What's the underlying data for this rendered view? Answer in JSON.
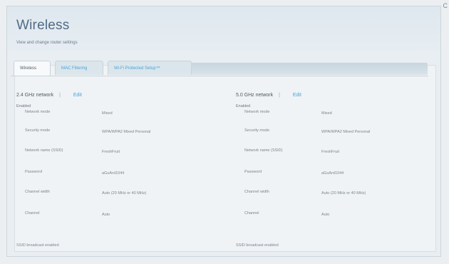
{
  "window": {
    "close_glyph": "C"
  },
  "header": {
    "title": "Wireless",
    "subtitle": "View and change router settings"
  },
  "tabs": [
    {
      "label": "Wireless",
      "active": true
    },
    {
      "label": "MAC Filtering",
      "active": false
    },
    {
      "label": "Wi-Fi Protected Setup™",
      "active": false
    }
  ],
  "networks": [
    {
      "title": "2.4 GHz network",
      "separator": "|",
      "edit_label": "Edit",
      "status": "Enabled",
      "rows": [
        {
          "key": "Network mode",
          "value": "Mixed"
        },
        {
          "key": "Security mode",
          "value": "WPA/WPA2 Mixed Personal"
        },
        {
          "key": "Network name (SSID)",
          "value": "FreshFruit"
        },
        {
          "key": "Password",
          "value": "aGuArd1044"
        },
        {
          "key": "Channel width",
          "value": "Auto (20 MHz or 40 MHz)"
        },
        {
          "key": "Channel",
          "value": "Auto"
        }
      ],
      "footer": "SSID broadcast enabled"
    },
    {
      "title": "5.0 GHz network",
      "separator": "|",
      "edit_label": "Edit",
      "status": "Enabled",
      "rows": [
        {
          "key": "Network mode",
          "value": "Mixed"
        },
        {
          "key": "Security mode",
          "value": "WPA/WPA2 Mixed Personal"
        },
        {
          "key": "Network name (SSID)",
          "value": "FreshFruit"
        },
        {
          "key": "Password",
          "value": "aGuArd1044"
        },
        {
          "key": "Channel width",
          "value": "Auto (20 MHz or 40 MHz)"
        },
        {
          "key": "Channel",
          "value": "Auto"
        }
      ],
      "footer": "SSID broadcast enabled"
    }
  ]
}
